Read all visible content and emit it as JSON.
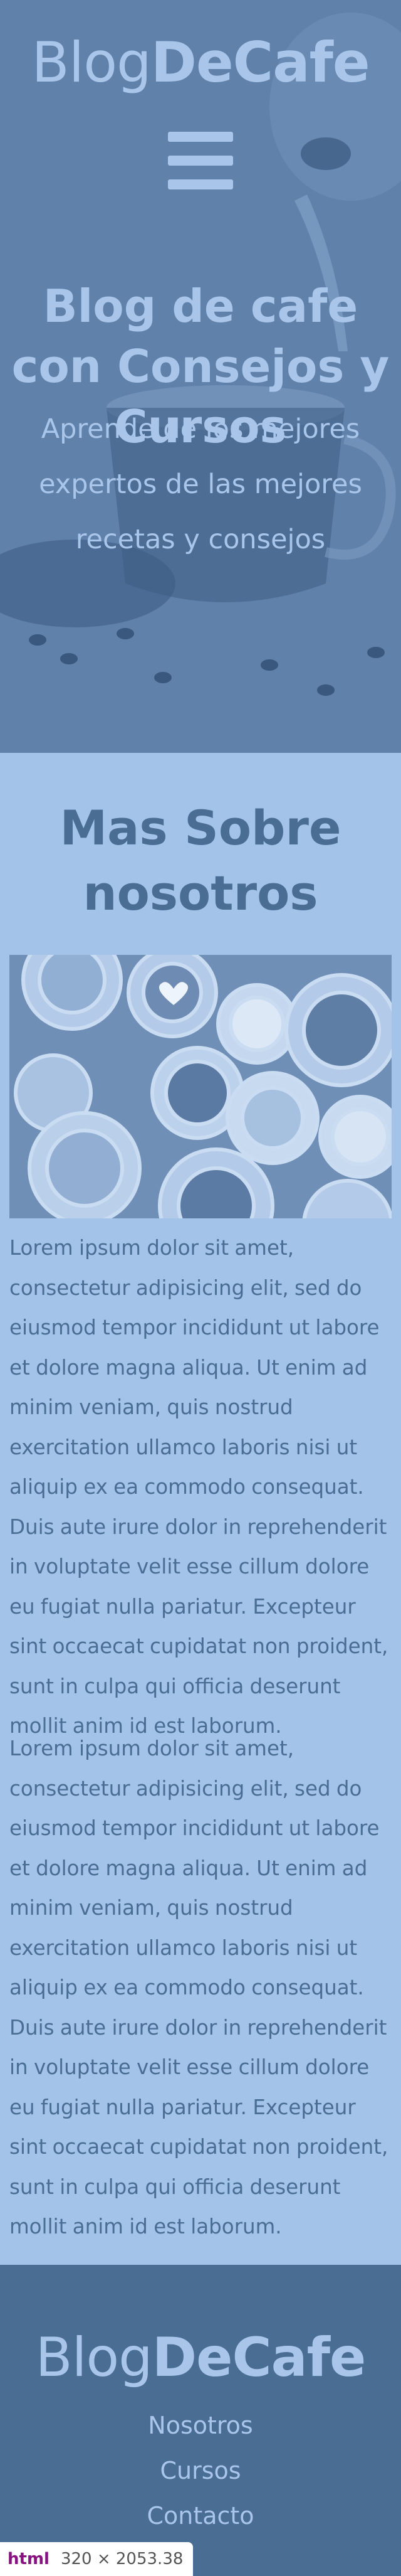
{
  "header": {
    "logo_light": "Blog",
    "logo_bold": "DeCafe",
    "title": "Blog de cafe con Consejos y Cursos",
    "subtitle": "Aprende de los mejores expertos de las mejores recetas y consejos"
  },
  "about": {
    "title": "Mas Sobre nosotros",
    "paragraphs": [
      "Lorem ipsum dolor sit amet, consectetur adipisicing elit, sed do eiusmod tempor incididunt ut labore et dolore magna aliqua. Ut enim ad minim veniam, quis nostrud exercitation ullamco laboris nisi ut aliquip ex ea commodo consequat. Duis aute irure dolor in reprehenderit in voluptate velit esse cillum dolore eu fugiat nulla pariatur. Excepteur sint occaecat cupidatat non proident, sunt in culpa qui officia deserunt mollit anim id est laborum.",
      "Lorem ipsum dolor sit amet, consectetur adipisicing elit, sed do eiusmod tempor incididunt ut labore et dolore magna aliqua. Ut enim ad minim veniam, quis nostrud exercitation ullamco laboris nisi ut aliquip ex ea commodo consequat. Duis aute irure dolor in reprehenderit in voluptate velit esse cillum dolore eu fugiat nulla pariatur. Excepteur sint occaecat cupidatat non proident, sunt in culpa qui officia deserunt mollit anim id est laborum."
    ]
  },
  "footer": {
    "logo_light": "Blog",
    "logo_bold": "DeCafe",
    "nav": [
      "Nosotros",
      "Cursos",
      "Contacto"
    ]
  },
  "devtools": {
    "tag": "html",
    "dimensions": "320 × 2053.38"
  },
  "colors": {
    "primary": "#4a6d94",
    "light": "#a3c4e8",
    "text_light": "#a9c6ea"
  },
  "icons": {
    "menu": "hamburger-menu-icon"
  }
}
